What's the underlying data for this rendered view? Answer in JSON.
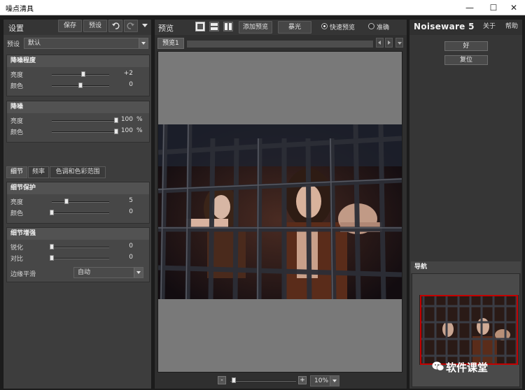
{
  "window": {
    "title": "噪点清具",
    "controls": [
      "—",
      "☐",
      "✕"
    ]
  },
  "left_panel": {
    "title": "设置",
    "save_label": "保存",
    "preset_label": "预设",
    "undo_icon": "undo-icon",
    "redo_icon": "redo-icon",
    "preset_row_label": "预设",
    "preset_value": "默认",
    "noise_level": {
      "header": "降噪程度",
      "rows": [
        {
          "label": "亮度",
          "value": "+2",
          "level": 0.55
        },
        {
          "label": "颜色",
          "value": "0",
          "level": 0.5
        }
      ]
    },
    "noise_reduction": {
      "header": "降噪",
      "rows": [
        {
          "label": "亮度",
          "value": "100",
          "unit": "%",
          "level": 1.0
        },
        {
          "label": "颜色",
          "value": "100",
          "unit": "%",
          "level": 1.0
        }
      ]
    },
    "tabs": [
      {
        "label": "细节",
        "active": true
      },
      {
        "label": "频率",
        "active": false
      },
      {
        "label": "色调和色彩范围",
        "active": false
      }
    ],
    "detail_protection": {
      "header": "细节保护",
      "rows": [
        {
          "label": "亮度",
          "value": "5",
          "level": 0.25
        },
        {
          "label": "颜色",
          "value": "0",
          "level": 0.0
        }
      ]
    },
    "detail_enhance": {
      "header": "细节增强",
      "rows": [
        {
          "label": "锐化",
          "value": "0",
          "level": 0.0
        },
        {
          "label": "对比",
          "value": "0",
          "level": 0.0
        }
      ],
      "edge_label": "边缘平滑",
      "edge_value": "自动"
    }
  },
  "center_panel": {
    "title": "预览",
    "add_preview_label": "添加预览",
    "exposure_label": "暴光",
    "fast_preview_label": "快速预览",
    "accurate_label": "准确",
    "preview_tab": "预览1",
    "zoom_minus": "-",
    "zoom_plus": "+",
    "zoom_value": "10%",
    "zoom_level": 0.05
  },
  "right_panel": {
    "logo": "Noiseware 5",
    "about_label": "关于",
    "help_label": "帮助",
    "ok_label": "好",
    "reset_label": "复位",
    "navigator_title": "导航",
    "watermark_text": "软件课堂"
  },
  "colors": {
    "panel": "#3d3d3d",
    "frame": "#c40000",
    "canvas": "#797979"
  }
}
